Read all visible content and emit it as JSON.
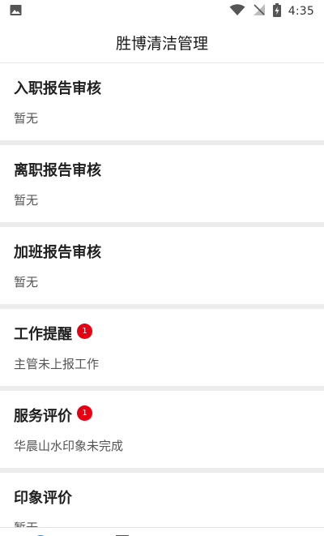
{
  "status_bar": {
    "time": "4:35",
    "icons": [
      "image-icon",
      "wifi-icon",
      "no-signal-icon",
      "battery-charging-icon"
    ]
  },
  "header": {
    "title": "胜博清洁管理"
  },
  "cards": [
    {
      "title": "入职报告审核",
      "subtitle": "暂无",
      "badge": ""
    },
    {
      "title": "离职报告审核",
      "subtitle": "暂无",
      "badge": ""
    },
    {
      "title": "加班报告审核",
      "subtitle": "暂无",
      "badge": ""
    },
    {
      "title": "工作提醒",
      "subtitle": "主管未上报工作",
      "badge": "1"
    },
    {
      "title": "服务评价",
      "subtitle": "华晨山水印象未完成",
      "badge": "1"
    },
    {
      "title": "印象评价",
      "subtitle": "暂无",
      "badge": ""
    }
  ],
  "colors": {
    "badge": "#e60012",
    "divider": "#ececec"
  },
  "bottom_nav": {
    "icons": [
      "home-icon",
      "edit-icon",
      "message-icon",
      "user-icon"
    ]
  }
}
